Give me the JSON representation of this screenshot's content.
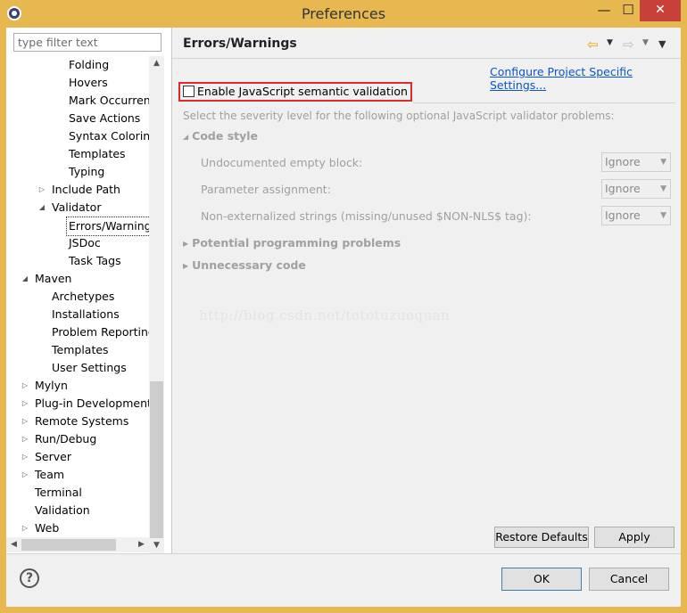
{
  "window": {
    "title": "Preferences",
    "minimize": "—",
    "maximize": "☐",
    "close": "✕"
  },
  "filter": {
    "placeholder": "type filter text"
  },
  "tree": [
    {
      "label": "Folding",
      "level": 3,
      "arrow": ""
    },
    {
      "label": "Hovers",
      "level": 3,
      "arrow": ""
    },
    {
      "label": "Mark Occurrences",
      "level": 3,
      "arrow": ""
    },
    {
      "label": "Save Actions",
      "level": 3,
      "arrow": ""
    },
    {
      "label": "Syntax Coloring",
      "level": 3,
      "arrow": ""
    },
    {
      "label": "Templates",
      "level": 3,
      "arrow": ""
    },
    {
      "label": "Typing",
      "level": 3,
      "arrow": ""
    },
    {
      "label": "Include Path",
      "level": 2,
      "arrow": "▷"
    },
    {
      "label": "Validator",
      "level": 2,
      "arrow": "◢"
    },
    {
      "label": "Errors/Warnings",
      "level": 3,
      "arrow": "",
      "selected": true
    },
    {
      "label": "JSDoc",
      "level": 3,
      "arrow": ""
    },
    {
      "label": "Task Tags",
      "level": 3,
      "arrow": ""
    },
    {
      "label": "Maven",
      "level": 1,
      "arrow": "◢"
    },
    {
      "label": "Archetypes",
      "level": 2,
      "arrow": ""
    },
    {
      "label": "Installations",
      "level": 2,
      "arrow": ""
    },
    {
      "label": "Problem Reporting",
      "level": 2,
      "arrow": ""
    },
    {
      "label": "Templates",
      "level": 2,
      "arrow": ""
    },
    {
      "label": "User Settings",
      "level": 2,
      "arrow": ""
    },
    {
      "label": "Mylyn",
      "level": 1,
      "arrow": "▷"
    },
    {
      "label": "Plug-in Development",
      "level": 1,
      "arrow": "▷"
    },
    {
      "label": "Remote Systems",
      "level": 1,
      "arrow": "▷"
    },
    {
      "label": "Run/Debug",
      "level": 1,
      "arrow": "▷"
    },
    {
      "label": "Server",
      "level": 1,
      "arrow": "▷"
    },
    {
      "label": "Team",
      "level": 1,
      "arrow": "▷"
    },
    {
      "label": "Terminal",
      "level": 1,
      "arrow": ""
    },
    {
      "label": "Validation",
      "level": 1,
      "arrow": ""
    },
    {
      "label": "Web",
      "level": 1,
      "arrow": "▷"
    }
  ],
  "page": {
    "title": "Errors/Warnings",
    "config_link": "Configure Project Specific Settings...",
    "enable_label": "Enable JavaScript semantic validation",
    "description": "Select the severity level for the following optional JavaScript validator problems:",
    "sections": {
      "code_style": "Code style",
      "potential": "Potential programming problems",
      "unnecessary": "Unnecessary code"
    },
    "options": [
      {
        "label": "Undocumented empty block:",
        "value": "Ignore"
      },
      {
        "label": "Parameter assignment:",
        "value": "Ignore"
      },
      {
        "label": "Non-externalized strings (missing/unused $NON-NLS$ tag):",
        "value": "Ignore"
      }
    ],
    "watermark": "http://blog.csdn.net/tototuzuoquan",
    "restore_defaults": "Restore Defaults",
    "apply": "Apply"
  },
  "footer": {
    "help": "?",
    "ok": "OK",
    "cancel": "Cancel"
  },
  "colors": {
    "accent": "#e6b84f",
    "close": "#c7413a",
    "link": "#0a55c8",
    "highlight": "#e02a2a"
  }
}
